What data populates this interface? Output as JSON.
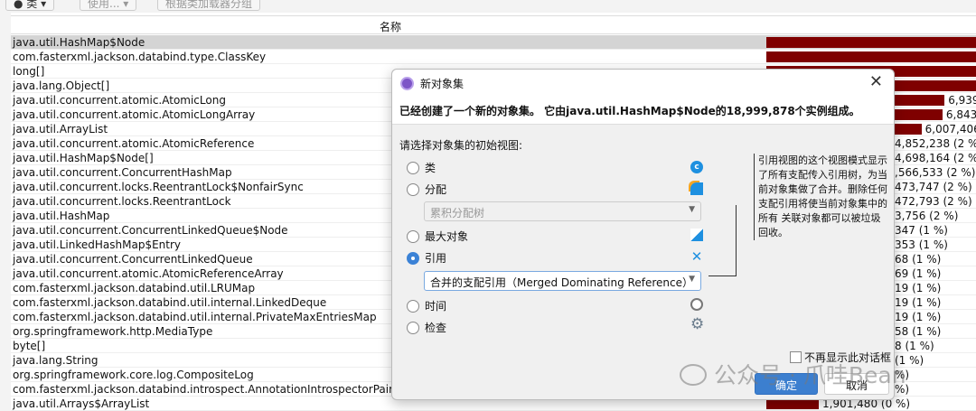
{
  "toolbar": {
    "buttons": [
      "● 类 ▾",
      "使用... ▾",
      "根据类加载器分组"
    ]
  },
  "table": {
    "header": "名称",
    "rows": [
      {
        "name": "java.util.HashMap$Node",
        "bar": 1.0,
        "value": ""
      },
      {
        "name": "com.fasterxml.jackson.databind.type.ClassKey",
        "bar": 1.0,
        "value": ""
      },
      {
        "name": "long[]",
        "bar": 1.0,
        "value": ""
      },
      {
        "name": "java.lang.Object[]",
        "bar": 1.0,
        "value": ""
      },
      {
        "name": "java.util.concurrent.atomic.AtomicLong",
        "bar": 0.85,
        "value": "6,939"
      },
      {
        "name": "java.util.concurrent.atomic.AtomicLongArray",
        "bar": 0.84,
        "value": "6,843,"
      },
      {
        "name": "java.util.ArrayList",
        "bar": 0.74,
        "value": "6,007,406"
      },
      {
        "name": "java.util.concurrent.atomic.AtomicReference",
        "bar": 0,
        "value": "4,852,238 (2 %)"
      },
      {
        "name": "java.util.HashMap$Node[]",
        "bar": 0,
        "value": "4,698,164 (2 %)"
      },
      {
        "name": "java.util.concurrent.ConcurrentHashMap",
        "bar": 0,
        "value": ",566,533 (2 %)"
      },
      {
        "name": "java.util.concurrent.locks.ReentrantLock$NonfairSync",
        "bar": 0,
        "value": "473,747 (2 %)"
      },
      {
        "name": "java.util.concurrent.locks.ReentrantLock",
        "bar": 0,
        "value": "472,793 (2 %)"
      },
      {
        "name": "java.util.HashMap",
        "bar": 0,
        "value": "3,756 (2 %)"
      },
      {
        "name": "java.util.concurrent.ConcurrentLinkedQueue$Node",
        "bar": 0,
        "value": "347 (1 %)"
      },
      {
        "name": "java.util.LinkedHashMap$Entry",
        "bar": 0,
        "value": "353 (1 %)"
      },
      {
        "name": "java.util.concurrent.ConcurrentLinkedQueue",
        "bar": 0,
        "value": "68 (1 %)"
      },
      {
        "name": "java.util.concurrent.atomic.AtomicReferenceArray",
        "bar": 0,
        "value": "69 (1 %)"
      },
      {
        "name": "com.fasterxml.jackson.databind.util.LRUMap",
        "bar": 0,
        "value": "19 (1 %)"
      },
      {
        "name": "com.fasterxml.jackson.databind.util.internal.LinkedDeque",
        "bar": 0,
        "value": "19 (1 %)"
      },
      {
        "name": "com.fasterxml.jackson.databind.util.internal.PrivateMaxEntriesMap",
        "bar": 0,
        "value": "19 (1 %)"
      },
      {
        "name": "org.springframework.http.MediaType",
        "bar": 0,
        "value": "58 (1 %)"
      },
      {
        "name": "byte[]",
        "bar": 0,
        "value": "8 (1 %)"
      },
      {
        "name": "java.lang.String",
        "bar": 0,
        "value": "(1 %)"
      },
      {
        "name": "org.springframework.core.log.CompositeLog",
        "bar": 0,
        "value": "%)"
      },
      {
        "name": "com.fasterxml.jackson.databind.introspect.AnnotationIntrospectorPair",
        "bar": 0,
        "value": "%)"
      },
      {
        "name": "java.util.Arrays$ArrayList",
        "bar": 0.25,
        "value": "1,901,480 (0 %)"
      }
    ]
  },
  "dialog": {
    "title": "新对象集",
    "message": "已经创建了一个新的对象集。 它由java.util.HashMap$Node的18,999,878个实例组成。",
    "prompt": "请选择对象集的初始视图:",
    "options": [
      {
        "label": "类"
      },
      {
        "label": "分配"
      },
      {
        "label": "最大对象"
      },
      {
        "label": "引用"
      },
      {
        "label": "时间"
      },
      {
        "label": "检查"
      }
    ],
    "allocation_select": "累积分配树",
    "reference_select": "合并的支配引用（Merged Dominating Reference）",
    "selected_option": "引用",
    "tooltip": "引用视图的这个视图模式显示了所有支配传入引用树，为当前对象集做了合并。删除任何支配引用将使当前对象集中的所有 关联对象都可以被垃圾回收。",
    "dont_show": "不再显示此对话框",
    "ok": "确定",
    "cancel": "取消"
  },
  "watermark": "公众号 · 爪哇Bean",
  "colors": {
    "bar": "#7f0000",
    "accent": "#3c7fcf"
  }
}
